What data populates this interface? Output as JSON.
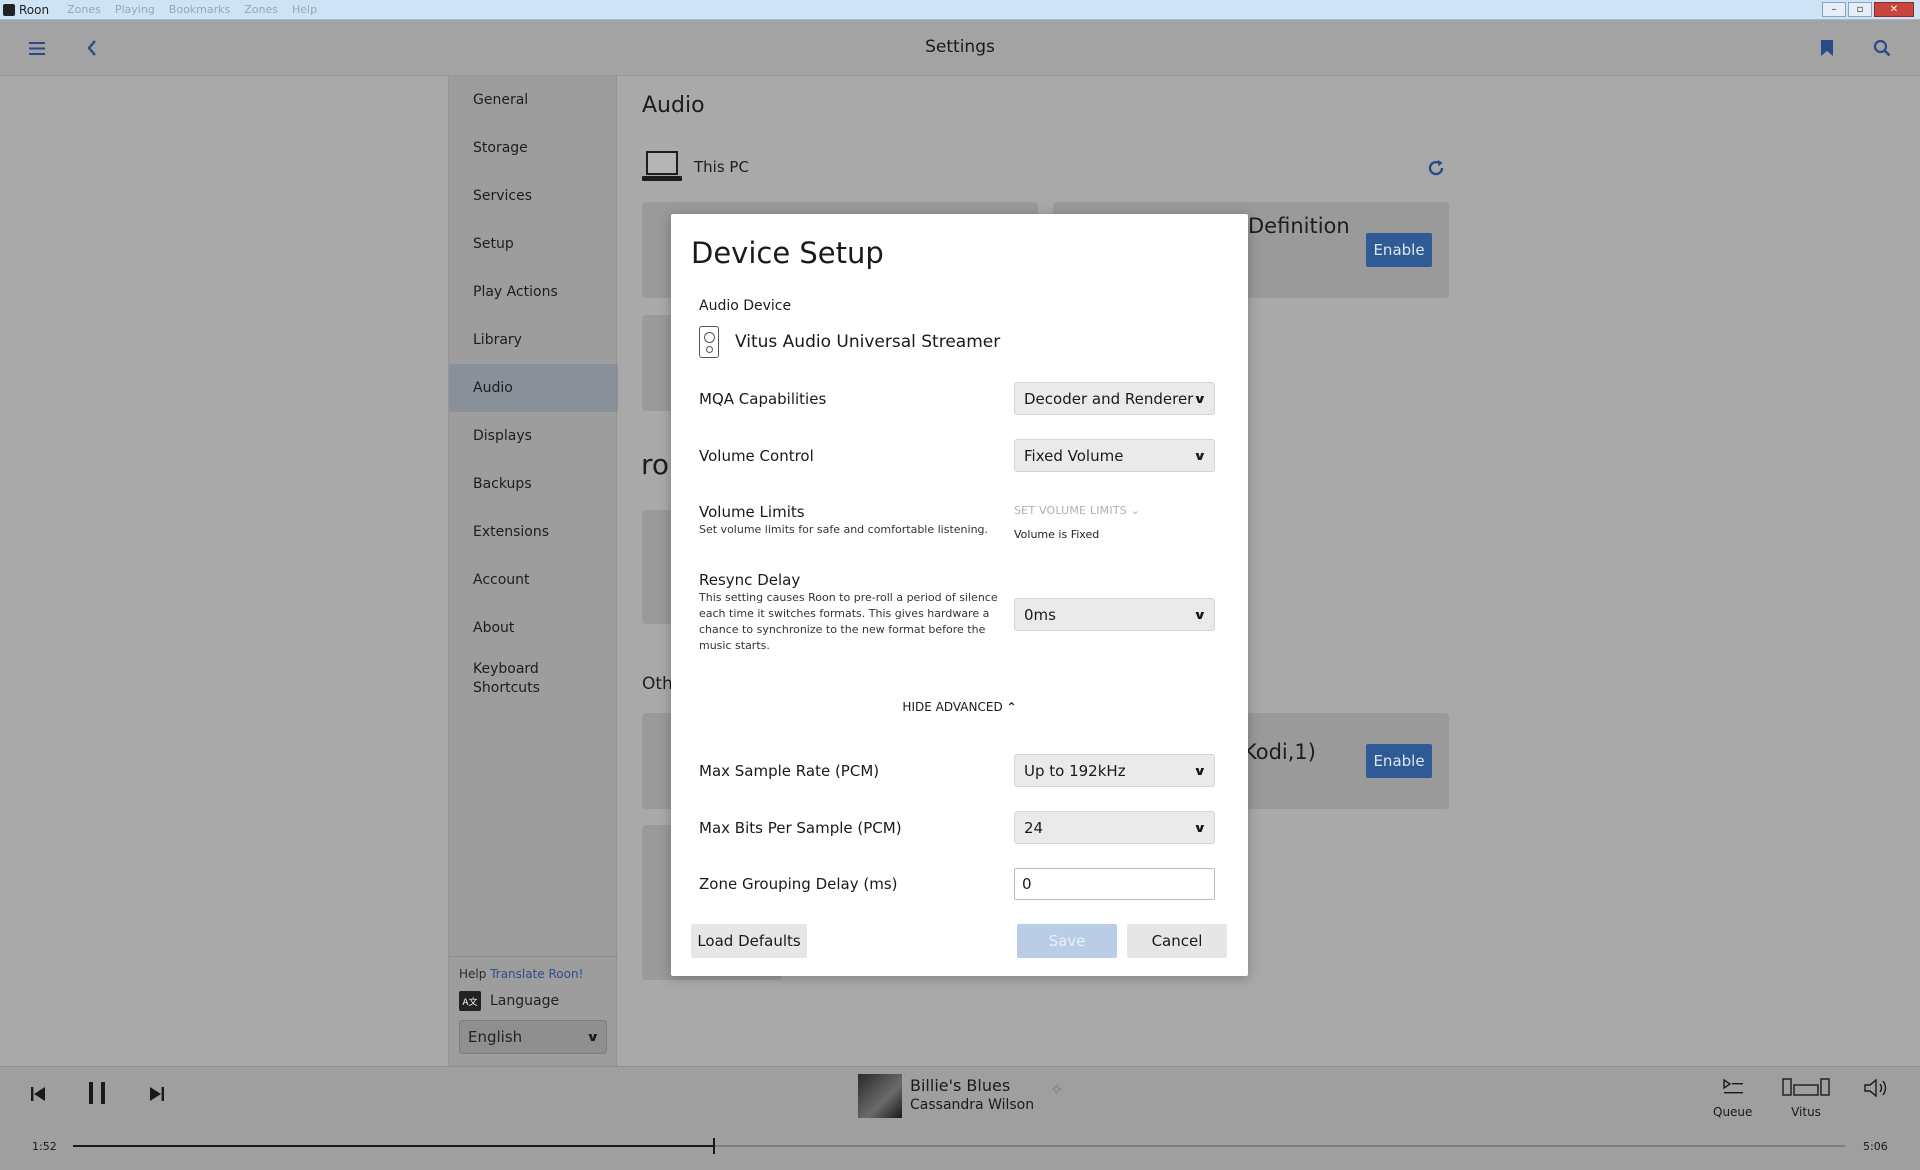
{
  "window": {
    "title": "Roon",
    "menu": [
      "Zones",
      "Playing",
      "Bookmarks",
      "Zones",
      "Help"
    ],
    "controls": {
      "minimize": "–",
      "maximize": "▫",
      "close": "✕"
    }
  },
  "header": {
    "title": "Settings",
    "icons": {
      "menu": "hamburger-icon",
      "back": "chevron-left-icon",
      "bookmark": "bookmark-icon",
      "search": "search-icon"
    }
  },
  "nav": {
    "items": [
      {
        "label": "General"
      },
      {
        "label": "Storage"
      },
      {
        "label": "Services"
      },
      {
        "label": "Setup"
      },
      {
        "label": "Play Actions"
      },
      {
        "label": "Library"
      },
      {
        "label": "Audio",
        "active": true
      },
      {
        "label": "Displays"
      },
      {
        "label": "Backups"
      },
      {
        "label": "Extensions"
      },
      {
        "label": "Account"
      },
      {
        "label": "About"
      },
      {
        "label": "Keyboard\nShortcuts"
      }
    ],
    "help_prefix": "Help",
    "help_link": "Translate Roon!",
    "language_label": "Language",
    "language_value": "English"
  },
  "main": {
    "title": "Audio",
    "device_group": "This PC",
    "bg_card1_text": "Definition",
    "bg_card2_text": "Kodi,1)",
    "section_roon_fragment": "ro",
    "section_other_fragment": "Oth",
    "enable_label": "Enable"
  },
  "dialog": {
    "title": "Device Setup",
    "audio_device_label": "Audio Device",
    "device_name": "Vitus Audio Universal Streamer",
    "mqa_label": "MQA Capabilities",
    "mqa_value": "Decoder and Renderer",
    "volume_control_label": "Volume Control",
    "volume_control_value": "Fixed Volume",
    "volume_limits_label": "Volume Limits",
    "volume_limits_desc": "Set volume limits for safe and comfortable listening.",
    "set_volume_limits": "SET VOLUME LIMITS",
    "volume_fixed_note": "Volume is Fixed",
    "resync_label": "Resync Delay",
    "resync_desc": "This setting causes Roon to pre-roll a period of silence each time it switches formats. This gives hardware a chance to synchronize to the new format before the music starts.",
    "resync_value": "0ms",
    "hide_advanced": "HIDE ADVANCED",
    "max_rate_label": "Max Sample Rate (PCM)",
    "max_rate_value": "Up to 192kHz",
    "max_bits_label": "Max Bits Per Sample (PCM)",
    "max_bits_value": "24",
    "zone_delay_label": "Zone Grouping Delay (ms)",
    "zone_delay_value": "0",
    "load_defaults": "Load Defaults",
    "save": "Save",
    "cancel": "Cancel"
  },
  "player": {
    "track_title": "Billie's Blues",
    "artist": "Cassandra Wilson",
    "elapsed": "1:52",
    "duration": "5:06",
    "progress": 0.362,
    "queue_label": "Queue",
    "zone_label": "Vitus"
  }
}
